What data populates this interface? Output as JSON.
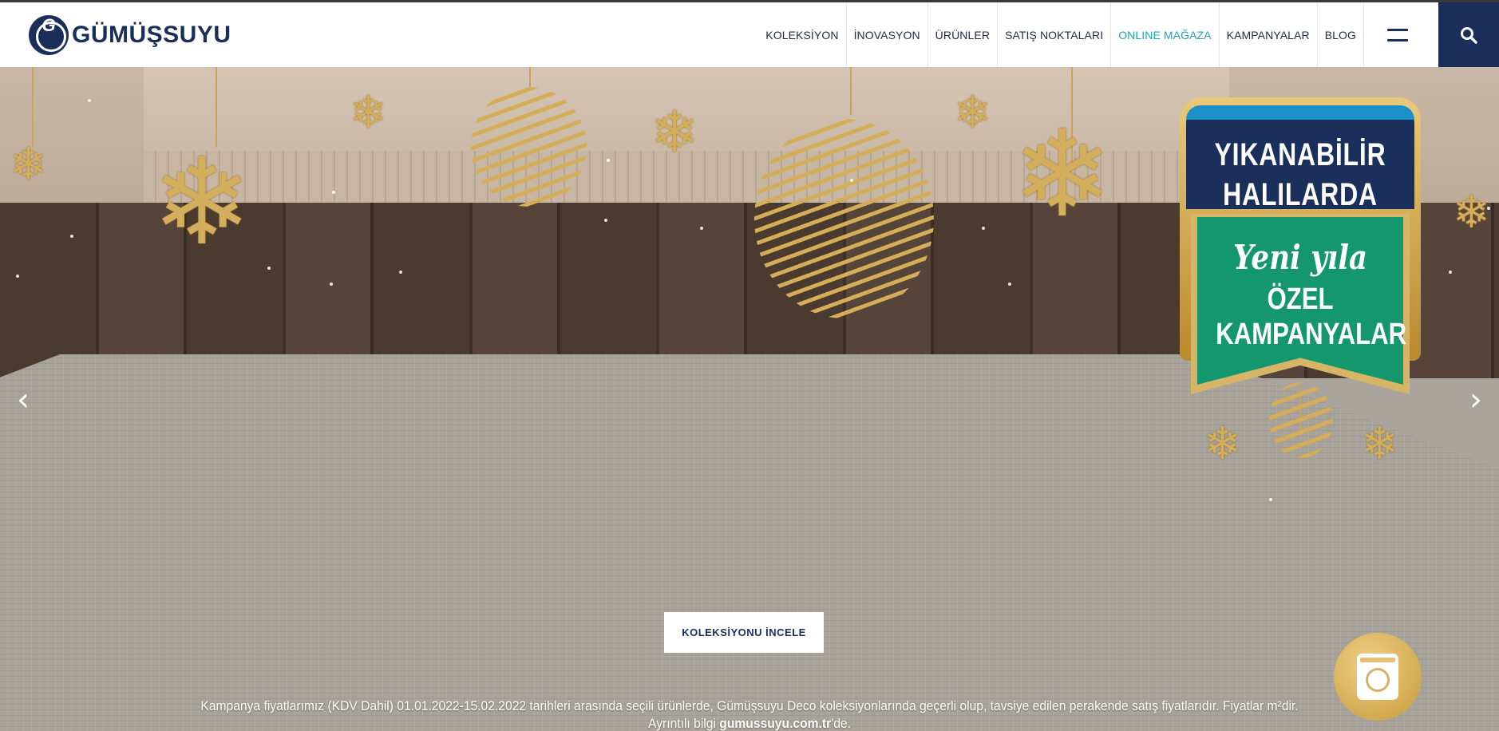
{
  "brand": {
    "logo_letter": "G",
    "name": "GÜMÜŞSUYU"
  },
  "nav": [
    {
      "label": "KOLEKSİYON"
    },
    {
      "label": "İNOVASYON"
    },
    {
      "label": "ÜRÜNLER"
    },
    {
      "label": "SATIŞ NOKTALARI"
    },
    {
      "label": "ONLINE MAĞAZA",
      "active": true
    },
    {
      "label": "KAMPANYALAR"
    },
    {
      "label": "BLOG"
    }
  ],
  "icons": {
    "menu": "hamburger-menu-icon",
    "search": "search-icon",
    "prev": "chevron-left-icon",
    "next": "chevron-right-icon",
    "washer": "washing-machine-icon"
  },
  "colors": {
    "brand_navy": "#1b2e5a",
    "accent_teal": "#1fa3b8",
    "badge_green": "#14976c",
    "gold": "#d3ae5c"
  },
  "hero": {
    "badge": {
      "line1": "YIKANABİLİR",
      "line2": "HALILARDA",
      "line3": "Yeni yıla",
      "line4": "ÖZEL",
      "line5": "KAMPANYALAR"
    },
    "arrow_prev": "‹",
    "arrow_next": "›",
    "cta_label": "KOLEKSİYONU İNCELE",
    "disclaimer_line1": "Kampanya fiyatlarımız (KDV Dahil) 01.01.2022-15.02.2022 tarihleri arasında seçili ürünlerde, Gümüşsuyu Deco koleksiyonlarında geçerli olup, tavsiye edilen perakende satış fiyatlarıdır. Fiyatlar m²dir.",
    "disclaimer_line2_prefix": "Ayrıntılı bilgi ",
    "disclaimer_link": "gumussuyu.com.tr",
    "disclaimer_line2_suffix": "'de."
  }
}
